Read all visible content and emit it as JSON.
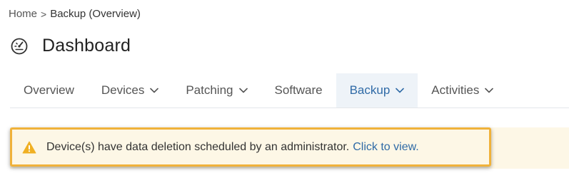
{
  "breadcrumb": {
    "home": "Home",
    "separator": ">",
    "current": "Backup (Overview)"
  },
  "page": {
    "title": "Dashboard",
    "icon": "dashboard-gauge-icon"
  },
  "tabs": [
    {
      "label": "Overview",
      "has_dropdown": false,
      "active": false
    },
    {
      "label": "Devices",
      "has_dropdown": true,
      "active": false
    },
    {
      "label": "Patching",
      "has_dropdown": true,
      "active": false
    },
    {
      "label": "Software",
      "has_dropdown": false,
      "active": false
    },
    {
      "label": "Backup",
      "has_dropdown": true,
      "active": true
    },
    {
      "label": "Activities",
      "has_dropdown": true,
      "active": false
    }
  ],
  "alert": {
    "icon": "warning-icon",
    "message": "Device(s) have data deletion scheduled by an administrator.",
    "link_text": "Click to view."
  },
  "colors": {
    "accent": "#2f6aa6",
    "active_tab_bg": "#eef3f8",
    "alert_border": "#f0b23a",
    "alert_bg": "#fdf7e6",
    "warning_icon": "#f0b023"
  }
}
